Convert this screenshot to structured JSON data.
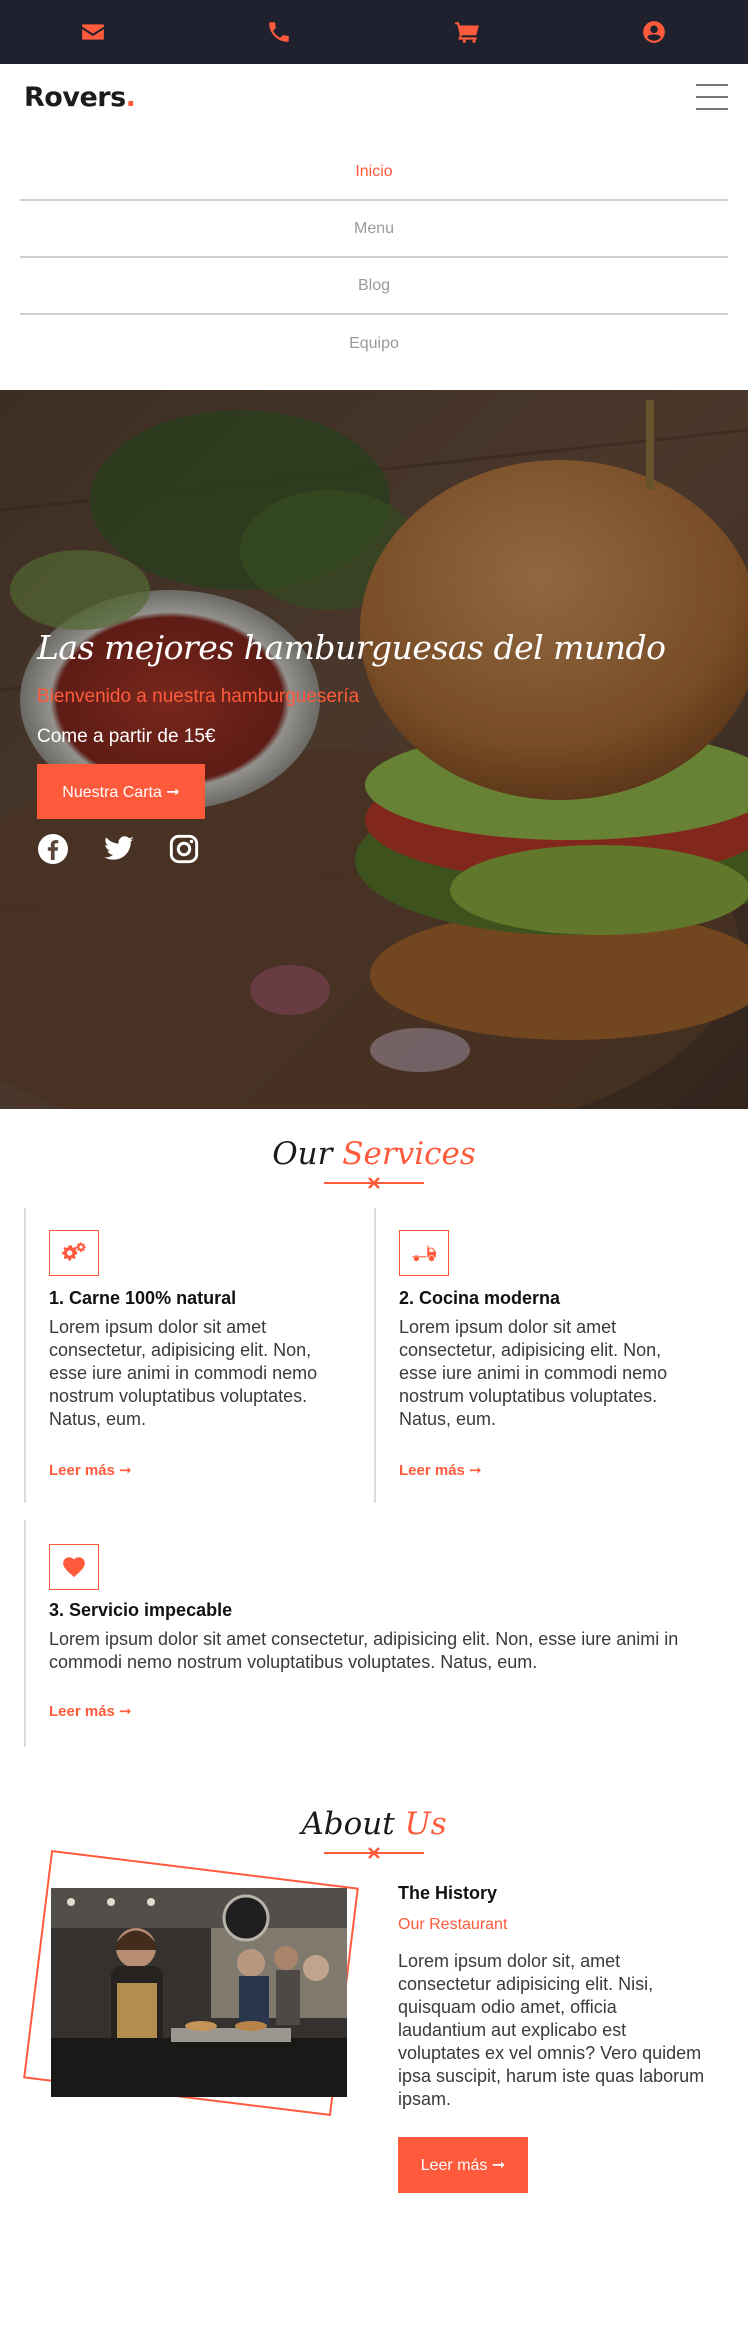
{
  "topbar": {
    "icons": [
      "envelope-icon",
      "phone-icon",
      "cart-icon",
      "user-circle-icon"
    ],
    "accent": "#ff5a3c",
    "background": "#20212e"
  },
  "header": {
    "brand": "Rovers",
    "brand_dot": ".",
    "menu_icon": "hamburger-menu-icon"
  },
  "nav": {
    "items": [
      {
        "label": "Inicio",
        "active": true
      },
      {
        "label": "Menu",
        "active": false
      },
      {
        "label": "Blog",
        "active": false
      },
      {
        "label": "Equipo",
        "active": false
      }
    ]
  },
  "hero": {
    "title": "Las mejores hamburguesas del mundo",
    "subtitle": "Bienvenido a nuestra hamburguesería",
    "price_text": "Come a partir de 15€",
    "button_label": "Nuestra Carta ➞",
    "social": [
      "facebook-icon",
      "twitter-icon",
      "instagram-icon"
    ]
  },
  "services": {
    "title_plain": "Our",
    "title_accent": "Services",
    "items": [
      {
        "icon": "gears-icon",
        "title": "1. Carne 100% natural",
        "text": "Lorem ipsum dolor sit amet consectetur, adipisicing elit. Non, esse iure animi in commodi nemo nostrum voluptatibus voluptates. Natus, eum.",
        "link": "Leer más ➞"
      },
      {
        "icon": "truck-icon",
        "title": "2. Cocina moderna",
        "text": "Lorem ipsum dolor sit amet consectetur, adipisicing elit. Non, esse iure animi in commodi nemo nostrum voluptatibus voluptates. Natus, eum.",
        "link": "Leer más ➞"
      },
      {
        "icon": "heart-icon",
        "title": "3. Servicio impecable",
        "text": "Lorem ipsum dolor sit amet consectetur, adipisicing elit. Non, esse iure animi in commodi nemo nostrum voluptatibus voluptates. Natus, eum.",
        "link": "Leer más ➞"
      }
    ]
  },
  "about": {
    "title_plain": "About",
    "title_accent": "Us",
    "heading": "The History",
    "subheading": "Our Restaurant",
    "text": "Lorem ipsum dolor sit, amet consectetur adipisicing elit. Nisi, quisquam odio amet, officia laudantium aut explicabo est voluptates ex vel omnis? Vero quidem ipsa suscipit, harum iste quas laborum ipsam.",
    "button_label": "Leer más ➞"
  }
}
